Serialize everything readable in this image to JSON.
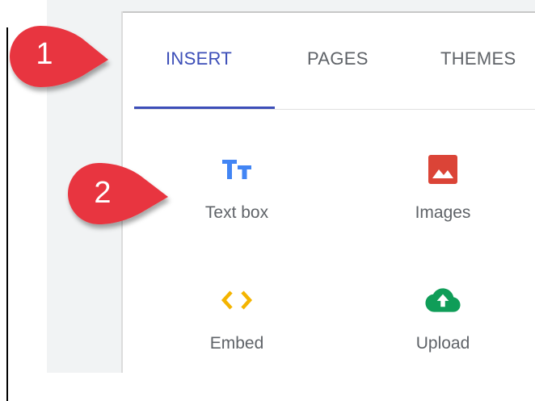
{
  "tabs": [
    {
      "label": "INSERT",
      "active": true
    },
    {
      "label": "PAGES",
      "active": false
    },
    {
      "label": "THEMES",
      "active": false
    }
  ],
  "insert_items": [
    {
      "label": "Text box",
      "icon": "text-box-icon",
      "color": "#4285f4"
    },
    {
      "label": "Images",
      "icon": "image-icon",
      "color": "#db4437"
    },
    {
      "label": "Embed",
      "icon": "embed-code-icon",
      "color": "#f4b400"
    },
    {
      "label": "Upload",
      "icon": "cloud-upload-icon",
      "color": "#0f9d58"
    }
  ],
  "callouts": [
    {
      "number": "1",
      "color": "#e8363f"
    },
    {
      "number": "2",
      "color": "#e8363f"
    }
  ],
  "colors": {
    "accent": "#3c4eb8",
    "tab_text": "#5f6368"
  }
}
